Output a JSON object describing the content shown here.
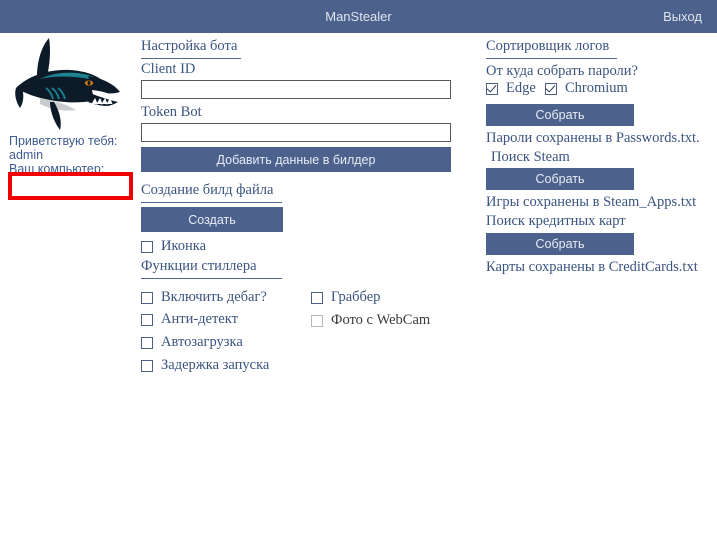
{
  "window": {
    "title": "ManStealer",
    "exit_label": "Выход"
  },
  "left": {
    "logo_name": "shark-logo",
    "greeting_label": "Приветствую тебя:",
    "username": "admin",
    "computer_label": "Ваш компьютер:",
    "computer_value": ""
  },
  "bot_settings": {
    "heading": "Настройка бота",
    "client_id_label": "Client ID",
    "client_id_value": "",
    "client_id_placeholder": "",
    "token_bot_label": "Token Bot",
    "token_bot_value": "",
    "token_bot_placeholder": "",
    "add_button": "Добавить данные в билдер"
  },
  "build_file": {
    "heading": "Создание билд файла",
    "create_button": "Создать",
    "icon_checkbox": {
      "label": "Иконка",
      "checked": false,
      "disabled": false
    }
  },
  "stealer_functions": {
    "heading": "Функции стиллера",
    "left_checkboxes": [
      {
        "label": "Включить дебаг?",
        "checked": false,
        "disabled": false
      },
      {
        "label": "Анти-детект",
        "checked": false,
        "disabled": false
      },
      {
        "label": "Автозагрузка",
        "checked": false,
        "disabled": false
      },
      {
        "label": "Задержка запуска",
        "checked": false,
        "disabled": false
      }
    ],
    "right_checkboxes": [
      {
        "label": "Граббер",
        "checked": false,
        "disabled": false
      },
      {
        "label": "Фото с WebCam",
        "checked": false,
        "disabled": true
      }
    ]
  },
  "log_sorter": {
    "heading": "Сортировщик логов",
    "passwords_question": "От куда собрать пароли?",
    "browser_checkboxes": [
      {
        "label": "Edge",
        "checked": true,
        "disabled": false
      },
      {
        "label": "Chromium",
        "checked": true,
        "disabled": false
      }
    ],
    "collect_passwords_button": "Собрать",
    "passwords_status": "Пароли сохранены в Passwords.txt.",
    "steam_label": "Поиск Steam",
    "collect_steam_button": "Собрать",
    "steam_status": "Игры сохранены в Steam_Apps.txt",
    "cards_label": "Поиск кредитных карт",
    "collect_cards_button": "Собрать",
    "cards_status": "Карты сохранены в CreditCards.txt"
  },
  "colors": {
    "accent": "#4c628d",
    "text": "#3b5480",
    "highlight_box_border": "#f00000"
  }
}
